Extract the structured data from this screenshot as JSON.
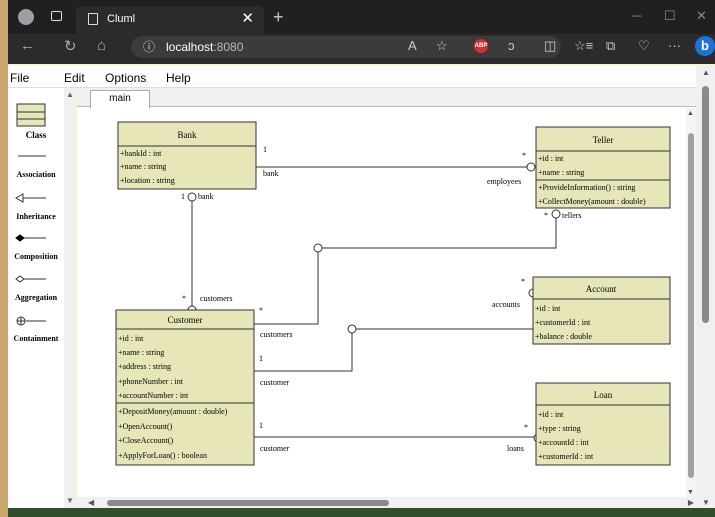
{
  "browser": {
    "tab_title": "Cluml",
    "close_glyph": "✕",
    "new_tab_glyph": "+",
    "url_host": "localhost",
    "url_port": ":8080",
    "controls": {
      "minimize": "─",
      "maximize": "☐",
      "close": "✕"
    },
    "nav": {
      "back": "←",
      "reload": "↻",
      "home": "⌂",
      "info": "ⓘ"
    },
    "toolbar_icons": {
      "read_aloud": "A",
      "favorite": "☆",
      "adblock": "ABP",
      "extensions": "ↄ",
      "split": "◫",
      "favorites": "☆≡",
      "collections": "⧉",
      "performance": "♡",
      "more": "···",
      "copilot": "b"
    }
  },
  "menu": [
    "File",
    "Edit",
    "Options",
    "Help"
  ],
  "palette": {
    "items": [
      {
        "label": "Class",
        "icon": "class-icon"
      },
      {
        "label": "Association",
        "icon": "association-icon"
      },
      {
        "label": "Inheritance",
        "icon": "inheritance-icon"
      },
      {
        "label": "Composition",
        "icon": "composition-icon"
      },
      {
        "label": "Aggregation",
        "icon": "aggregation-icon"
      },
      {
        "label": "Containment",
        "icon": "containment-icon"
      }
    ]
  },
  "diagram_tab": "main",
  "classes": {
    "bank": {
      "name": "Bank",
      "attributes": [
        "+bankId : int",
        "+name : string",
        "+location : string"
      ]
    },
    "teller": {
      "name": "Teller",
      "attributes": [
        "+id : int",
        "+name : string"
      ],
      "methods": [
        "+ProvideInformation() : string",
        "+CollectMoney(amount : double)"
      ]
    },
    "customer": {
      "name": "Customer",
      "attributes": [
        "+id : int",
        "+name : string",
        "+address : string",
        "+phoneNumber : int",
        "+accountNumber : int"
      ],
      "methods": [
        "+DepositMoney(amount : double)",
        "+OpenAccount()",
        "+CloseAccount()",
        "+ApplyForLoan() : boolean"
      ]
    },
    "account": {
      "name": "Account",
      "attributes": [
        "+id : int",
        "+customerId : int",
        "+balance : double"
      ]
    },
    "loan": {
      "name": "Loan",
      "attributes": [
        "+id : int",
        "+type : string",
        "+accountId : int",
        "+customerId : int"
      ]
    }
  },
  "labels": {
    "bank_teller_mult": "1",
    "bank_teller_role": "bank",
    "teller_bank_mult": "*",
    "teller_bank_role": "employees",
    "bank_cust_mult": "1",
    "bank_cust_role": "bank",
    "cust_bank_mult": "*",
    "cust_bank_role": "customers",
    "teller_cust_mult": "*",
    "teller_cust_role": "tellers",
    "cust_teller_mult": "*",
    "cust_teller_role": "customers",
    "cust_acc_mult": "1",
    "cust_acc_role": "customer",
    "acc_cust_mult": "*",
    "acc_cust_role": "accounts",
    "cust_loan_mult": "1",
    "cust_loan_role": "customer",
    "loan_cust_mult": "*",
    "loan_cust_role": "loans"
  },
  "colors": {
    "class_fill": "#e6e6b8",
    "class_stroke": "#333333",
    "canvas": "#ffffff",
    "page_bg": "#f6f2d9"
  }
}
